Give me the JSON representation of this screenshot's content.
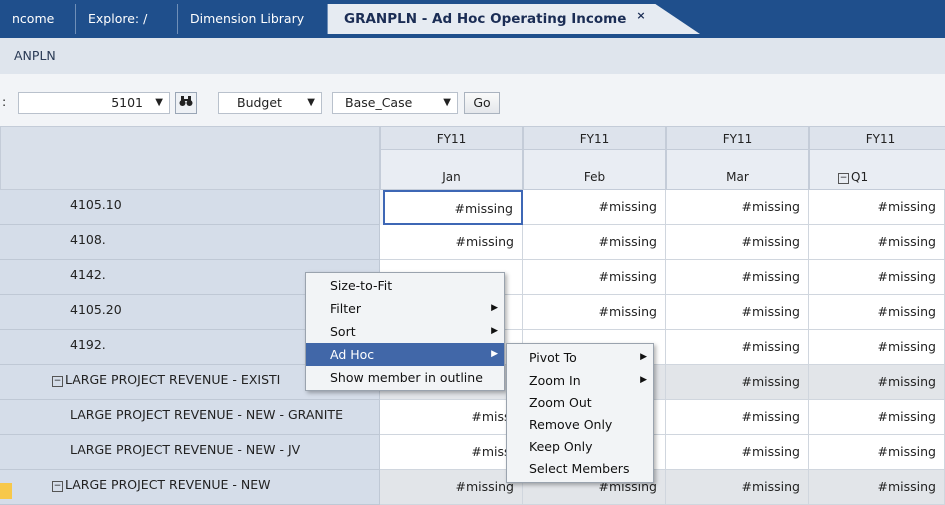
{
  "tabs": [
    {
      "label": "ncome"
    },
    {
      "label": "Explore: /"
    },
    {
      "label": "Dimension Library"
    },
    {
      "label": "GRANPLN - Ad Hoc Operating Income",
      "close": "×",
      "active": true
    }
  ],
  "breadcrumb": "ANPLN",
  "pov": {
    "prefix": ":",
    "entity_value": "5101",
    "scenario_value": "Budget",
    "version_value": "Base_Case",
    "go_label": "Go"
  },
  "grid": {
    "columns": [
      {
        "year": "FY11",
        "period": "Jan"
      },
      {
        "year": "FY11",
        "period": "Feb"
      },
      {
        "year": "FY11",
        "period": "Mar"
      },
      {
        "year": "FY11",
        "period": "Q1",
        "expander": "−"
      }
    ],
    "rows": [
      {
        "label": "4105.10",
        "values": [
          "#missing",
          "#missing",
          "#missing",
          "#missing"
        ]
      },
      {
        "label": "4108.",
        "values": [
          "#missing",
          "#missing",
          "#missing",
          "#missing"
        ]
      },
      {
        "label": "4142.",
        "values": [
          "",
          "#missing",
          "#missing",
          "#missing"
        ]
      },
      {
        "label": "4105.20",
        "values": [
          "",
          "#missing",
          "#missing",
          "#missing"
        ]
      },
      {
        "label": "4192.",
        "values": [
          "",
          "",
          "#missing",
          "#missing"
        ]
      },
      {
        "label": "LARGE PROJECT REVENUE - EXISTI",
        "expander": "−",
        "values": [
          "",
          "",
          "#missing",
          "#missing"
        ]
      },
      {
        "label": "LARGE PROJECT REVENUE - NEW - GRANITE",
        "values": [
          "#missi",
          "",
          "#missing",
          "#missing"
        ]
      },
      {
        "label": "LARGE PROJECT REVENUE - NEW - JV",
        "values": [
          "#missi",
          "",
          "#missing",
          "#missing"
        ]
      },
      {
        "label": "LARGE PROJECT REVENUE - NEW",
        "expander": "−",
        "values": [
          "#missing",
          "#missing",
          "#missing",
          "#missing"
        ]
      }
    ]
  },
  "context_menu": {
    "items": [
      "Size-to-Fit",
      "Filter",
      "Sort",
      "Ad Hoc",
      "Show member in outline"
    ],
    "submenu_arrow": "▶"
  },
  "adhoc_submenu": {
    "items": [
      "Pivot To",
      "Zoom In",
      "Zoom Out",
      "Remove Only",
      "Keep Only",
      "Select Members"
    ]
  },
  "icons": {
    "find": "binoculars-icon",
    "dropdown": "▼"
  },
  "colors": {
    "tabbar": "#1f4f8c",
    "menu_highlight": "#4167a8",
    "selected_cell_border": "#3e67b5"
  }
}
